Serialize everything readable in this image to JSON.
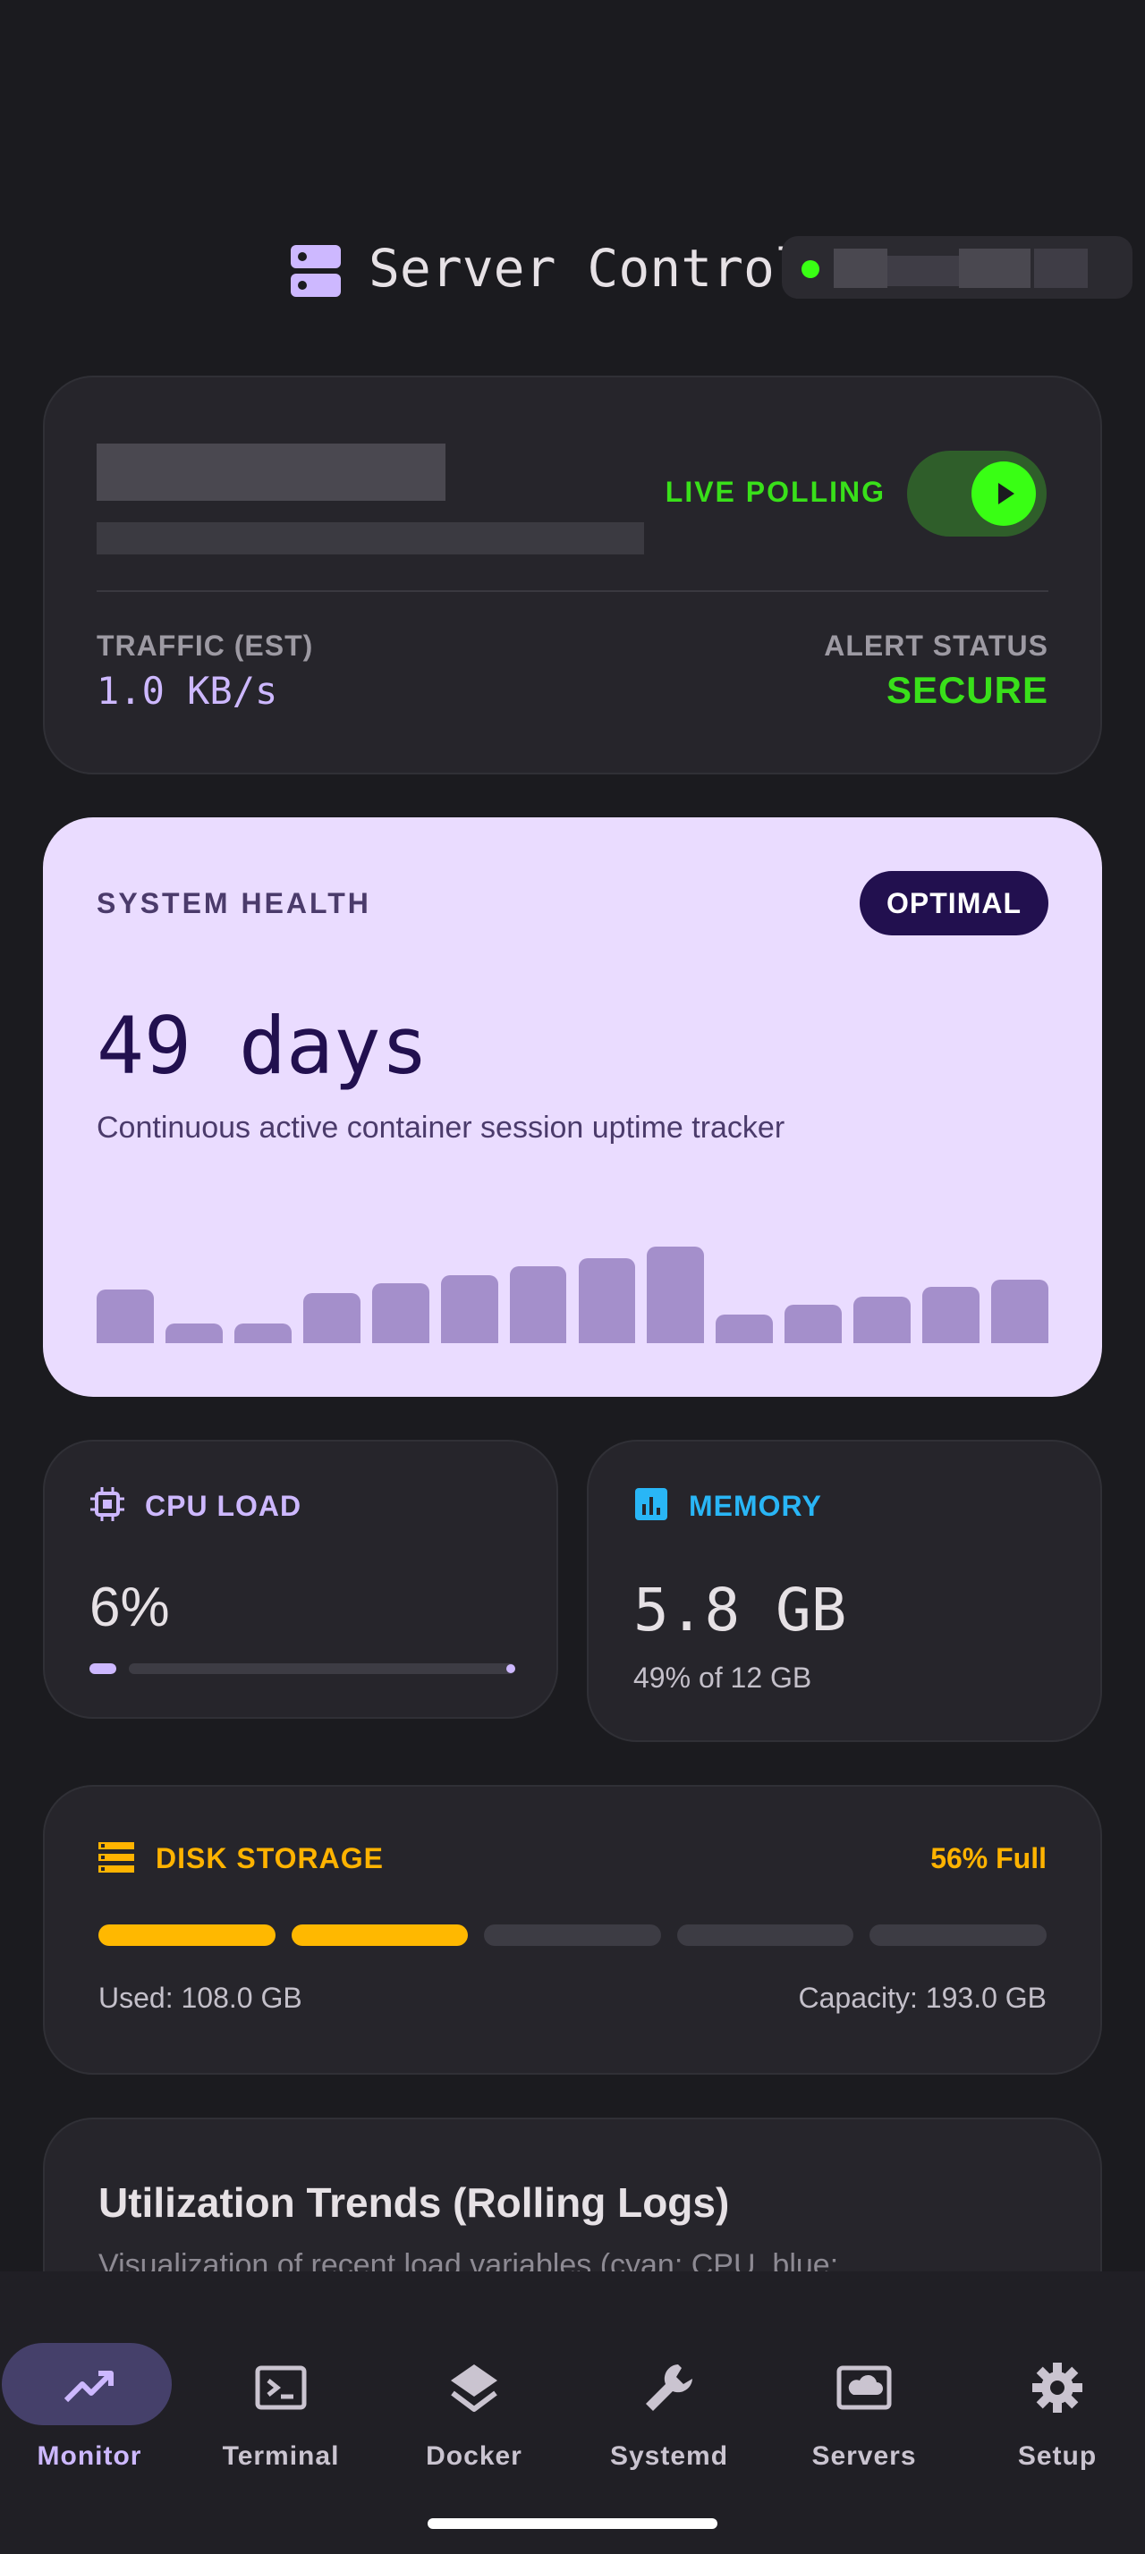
{
  "header": {
    "title": "Server Control",
    "status_color": "#39ff14"
  },
  "polling_card": {
    "live_polling_label": "LIVE POLLING",
    "traffic_label": "TRAFFIC (EST)",
    "traffic_value": "1.0 KB/s",
    "alert_label": "ALERT STATUS",
    "alert_value": "SECURE",
    "toggle_on": true
  },
  "health_card": {
    "label": "SYSTEM HEALTH",
    "badge": "OPTIMAL",
    "uptime": "49 days",
    "subtitle": "Continuous active container session uptime tracker",
    "sparkline": [
      0.56,
      0.2,
      0.2,
      0.52,
      0.62,
      0.7,
      0.8,
      0.88,
      1.0,
      0.3,
      0.4,
      0.48,
      0.58,
      0.66
    ]
  },
  "cpu_card": {
    "label": "CPU LOAD",
    "value": "6%",
    "load_fraction": 0.06,
    "icon": "cpu-chip-icon"
  },
  "memory_card": {
    "label": "MEMORY",
    "value": "5.8 GB",
    "sub": "49% of 12 GB",
    "icon": "memory-chart-icon"
  },
  "disk_card": {
    "label": "DISK STORAGE",
    "percent": "56% Full",
    "used": "Used: 108.0 GB",
    "capacity": "Capacity: 193.0 GB",
    "segments_filled": 2,
    "segments_total": 5,
    "icon": "storage-stack-icon"
  },
  "trends_card": {
    "title": "Utilization Trends (Rolling Logs)",
    "subtitle": "Visualization of recent load variables (cyan: CPU, blue:"
  },
  "nav": {
    "items": [
      {
        "label": "Monitor",
        "icon": "trending-up-icon"
      },
      {
        "label": "Terminal",
        "icon": "terminal-icon"
      },
      {
        "label": "Docker",
        "icon": "layers-icon"
      },
      {
        "label": "Systemd",
        "icon": "wrench-icon"
      },
      {
        "label": "Servers",
        "icon": "cloud-server-icon"
      },
      {
        "label": "Setup",
        "icon": "gear-icon"
      }
    ]
  },
  "colors": {
    "accent": "#cdb8ff",
    "live_green": "#39ff14",
    "memory_blue": "#29b6f6",
    "disk_amber": "#ffb300"
  }
}
